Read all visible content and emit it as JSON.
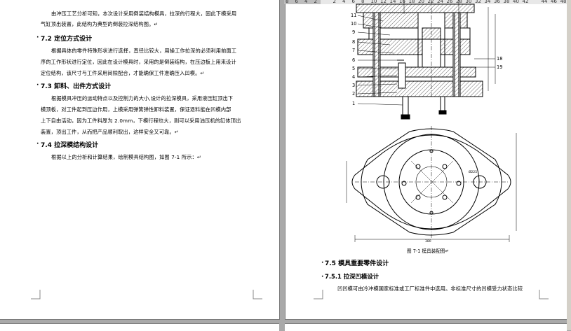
{
  "ruler": {
    "ticks": [
      "8",
      "6",
      "4",
      "2",
      "",
      "2",
      "4",
      "6",
      "8",
      "10",
      "12",
      "14",
      "16",
      "18",
      "20",
      "22",
      "24",
      "26",
      "28",
      "30",
      "32",
      "34",
      "36",
      "38",
      "40",
      "42",
      "",
      "44",
      "46",
      "48"
    ]
  },
  "left_page": {
    "line1": "由冲压工艺分析可知，本次设计采用倒装结构模具，拉深的行程大，固此下模采用",
    "line2": "气缸顶出装置，此结构为典型的倒装拉深结构图。↵",
    "s72_title": "7.2 定位方式设计",
    "s72_l1": "根据具体的零件特殊形状进行选择，直径比较大，用操工作拉深的必须利用前面工",
    "s72_l2": "序的工作形状进行定位，因此在设计模具时，采用的是倒装结构，在压边板上用来设计",
    "s72_l3": "定位结构，该尺寸与工件采用间隙配合，才能确保工件准确压入凹模。↵",
    "s73_title": "7.3 卸料、出件方式设计",
    "s73_l1": "根据模具冲压的运动特点以及控制力的大小,设计的拉深模具，采用液压缸顶出下",
    "s73_l2": "模顶板，对工件起到压边作用，上模采用弹簧弹性卸料装置，保证退料能在凹模内部",
    "s73_l3": "上下自由活动，因为工件料厚为 2.0mm，下模行程也大，则可以采用油压机的缸体顶出",
    "s73_l4": "装置，顶出工件，从而把产品顺利取出，这样安全又可靠。↵",
    "s74_title": "7.4 拉深模结构设计",
    "s74_l1": "根据以上的分析和计算结果，绘制模具结构图，如图 7-1 所示：↵"
  },
  "right_page": {
    "callouts_left": [
      "11",
      "10",
      "9",
      "8",
      "7",
      "6",
      "5",
      "4",
      "3",
      "2",
      "1"
    ],
    "callouts_right": [
      "18",
      "19"
    ],
    "caption": "图 7-1   模具装配图↵",
    "s75_title": "7.5 模具重要零件设计",
    "s751_title": "7.5.1 拉深凹模设计",
    "s751_l1": "凹凹模可由冷冲模国家标准或工厂标准件中选用。非标准尺寸的凹模受力状态比较",
    "dim_top": "Ø225",
    "dim_bottom": "380"
  }
}
